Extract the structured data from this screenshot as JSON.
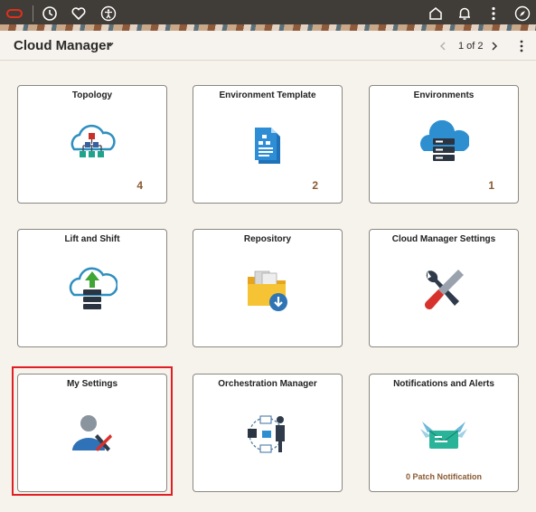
{
  "header": {
    "title": "Cloud Manager",
    "pager": "1 of 2"
  },
  "topbar_icons": [
    "oracle-logo",
    "history-icon",
    "favorites-icon",
    "accessibility-icon",
    "home-icon",
    "notifications-icon",
    "actions-menu-icon",
    "navigator-icon"
  ],
  "tiles": [
    {
      "title": "Topology",
      "icon": "topology-icon",
      "count": "4"
    },
    {
      "title": "Environment Template",
      "icon": "document-icon",
      "count": "2"
    },
    {
      "title": "Environments",
      "icon": "cloud-server-icon",
      "count": "1"
    },
    {
      "title": "Lift and Shift",
      "icon": "cloud-upload-icon",
      "count": ""
    },
    {
      "title": "Repository",
      "icon": "folder-download-icon",
      "count": ""
    },
    {
      "title": "Cloud Manager Settings",
      "icon": "tools-icon",
      "count": ""
    },
    {
      "title": "My Settings",
      "icon": "user-settings-icon",
      "count": ""
    },
    {
      "title": "Orchestration Manager",
      "icon": "orchestration-icon",
      "count": ""
    },
    {
      "title": "Notifications and Alerts",
      "icon": "notification-icon",
      "footer": "0  Patch Notification"
    }
  ],
  "colors": {
    "accent": "#8a5a32",
    "highlight": "#e01e24",
    "topbar": "#403c37"
  }
}
